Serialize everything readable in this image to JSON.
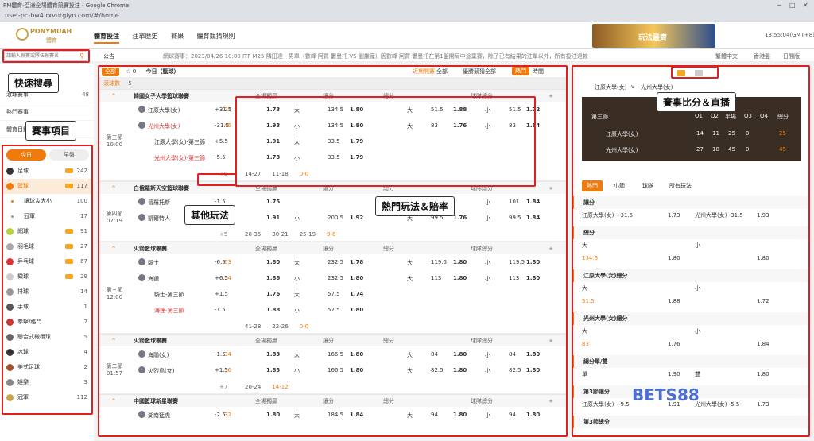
{
  "browser": {
    "title": "PM體育-亞洲全場體育競賽投注 - Google Chrome",
    "url": "user-pc-bw4.rxvutgiyn.com/#/home",
    "controls": [
      "─",
      "□",
      "✕"
    ]
  },
  "header": {
    "brand": "PONYMUAH",
    "brand_sub": "體育",
    "nav": [
      "體育投注",
      "注單歷史",
      "賽果",
      "體育競猜規則"
    ],
    "banner_text": "玩法最齊",
    "clock": "13:55:04(GMT+8)"
  },
  "subbar": {
    "announce_label": "公告",
    "announce": "網球賽事：2023/04/26 10:00 ITF M25 隣田達 - 男單（數峰·阿買 鬱曼托 VS 劉謙龐）因數峰·阿買·鬱曼托在第1盤開局中途棄賽，除了已有結果的注單以外，所有投注退款",
    "lang": "繁體中文",
    "odds_type": "香港盤",
    "theme": "日間版"
  },
  "search": {
    "placeholder": "請輸入聯賽或隊伍聯賽名"
  },
  "labels": {
    "search": "快速搜尋",
    "events": "賽事項目",
    "other": "其他玩法",
    "hot": "熱門玩法＆賠率",
    "live": "賽事比分＆直播"
  },
  "sidebar": {
    "top": [
      {
        "name": "滾球賽事",
        "count": "48"
      },
      {
        "name": "熱門賽事",
        "count": ""
      },
      {
        "name": "體育目錄",
        "count": ""
      }
    ],
    "tabs": [
      "今日",
      "早盤"
    ],
    "sports": [
      {
        "name": "足球",
        "count": "242",
        "color": "#333"
      },
      {
        "name": "籃球",
        "count": "117",
        "color": "#f07b0d",
        "active": true
      },
      {
        "name": "讓球＆大小",
        "count": "100",
        "color": "#f07b0d",
        "sub": true
      },
      {
        "name": "冠軍",
        "count": "17",
        "color": "#999",
        "sub": true
      },
      {
        "name": "網球",
        "count": "91",
        "color": "#b5d23a"
      },
      {
        "name": "羽毛球",
        "count": "27",
        "color": "#aaa"
      },
      {
        "name": "乒乓球",
        "count": "67",
        "color": "#d33"
      },
      {
        "name": "橄球",
        "count": "29",
        "color": "#ccc"
      },
      {
        "name": "排球",
        "count": "14",
        "color": "#999"
      },
      {
        "name": "手球",
        "count": "1",
        "color": "#555"
      },
      {
        "name": "拳擊/格鬥",
        "count": "2",
        "color": "#c33"
      },
      {
        "name": "聯合式橄欖球",
        "count": "5",
        "color": "#666"
      },
      {
        "name": "冰球",
        "count": "4",
        "color": "#333"
      },
      {
        "name": "美式足球",
        "count": "2",
        "color": "#a0522d"
      },
      {
        "name": "娛樂",
        "count": "3",
        "color": "#888"
      },
      {
        "name": "冠軍",
        "count": "112",
        "color": "#c8a24a"
      }
    ]
  },
  "main": {
    "filter_all": "全部",
    "star_count": "0",
    "title": "今日（籃球）",
    "sort_near": "近期開賽",
    "sort_all1": "全部",
    "sort_win": "優勝競猜",
    "sort_all2": "全部",
    "hot": "熱門",
    "time": "時間",
    "live_label": "滾球數",
    "live_count": "5",
    "col_headers": [
      "全場獨贏",
      "讓分",
      "總分",
      "球隊總分"
    ],
    "leagues": [
      {
        "name": "韓國女子大學籃球聯賽",
        "time": "第三節",
        "clock": "10:00",
        "home": "江原大學(女)",
        "away": "光州大學(女)",
        "score_home": "25",
        "score_away": "45",
        "rows": [
          [
            "",
            "+31.5",
            "1.73",
            "大",
            "134.5",
            "1.80",
            "大",
            "51.5",
            "1.88",
            "小",
            "51.5",
            "1.72"
          ],
          [
            "",
            "-31.5",
            "1.93",
            "小",
            "134.5",
            "1.80",
            "大",
            "83",
            "1.76",
            "小",
            "83",
            "1.84"
          ],
          [
            "江原大學(女)-第三節",
            "+5.5",
            "1.91",
            "大",
            "33.5",
            "1.79",
            "",
            "",
            "",
            "",
            "",
            ""
          ],
          [
            "光州大學(女)-第三節",
            "-5.5",
            "1.73",
            "小",
            "33.5",
            "1.79",
            "",
            "",
            "",
            "",
            "",
            ""
          ]
        ],
        "more": "+8",
        "q": [
          "14-27",
          "11-18",
          "0-0"
        ]
      },
      {
        "name": "白俄羅斯天空籃球聯賽",
        "time": "第四節",
        "clock": "07:19",
        "home": "晉羅托斯",
        "away": "凱爾特人",
        "score_home": "",
        "score_away": "",
        "rows": [
          [
            "",
            "-1.5",
            "1.75",
            "",
            "",
            "",
            "",
            "",
            "",
            "小",
            "101",
            "1.84"
          ],
          [
            "",
            "+1.5",
            "1.91",
            "小",
            "200.5",
            "1.92",
            "大",
            "99.5",
            "1.76",
            "小",
            "99.5",
            "1.84"
          ]
        ],
        "more": "+5",
        "q": [
          "20-35",
          "30-21",
          "25-19",
          "9-6"
        ]
      },
      {
        "name": "火箭籃球聯賽",
        "time": "第三節",
        "clock": "12:00",
        "home": "騎士",
        "away": "海狸",
        "score_home": "63",
        "score_away": "54",
        "rows": [
          [
            "",
            "-6.5",
            "1.80",
            "大",
            "232.5",
            "1.78",
            "大",
            "119.5",
            "1.80",
            "小",
            "119.5",
            "1.80"
          ],
          [
            "",
            "+6.5",
            "1.86",
            "小",
            "232.5",
            "1.80",
            "大",
            "113",
            "1.80",
            "小",
            "113",
            "1.80"
          ],
          [
            "騎士-第三節",
            "+1.5",
            "1.76",
            "大",
            "57.5",
            "1.74",
            "",
            "",
            "",
            "",
            "",
            ""
          ],
          [
            "海狸-第三節",
            "-1.5",
            "1.88",
            "小",
            "57.5",
            "1.80",
            "",
            "",
            "",
            "",
            "",
            ""
          ]
        ],
        "more": "",
        "q": [
          "41-28",
          "22-26",
          "0-0"
        ]
      },
      {
        "name": "火箭籃球聯賽",
        "time": "第二節",
        "clock": "01:57",
        "home": "海鵰(女)",
        "away": "火烈鳥(女)",
        "score_home": "34",
        "score_away": "36",
        "rows": [
          [
            "",
            "-1.5",
            "1.83",
            "大",
            "166.5",
            "1.80",
            "大",
            "84",
            "1.80",
            "小",
            "84",
            "1.80"
          ],
          [
            "",
            "+1.5",
            "1.83",
            "小",
            "166.5",
            "1.80",
            "大",
            "82.5",
            "1.80",
            "小",
            "82.5",
            "1.80"
          ]
        ],
        "more": "+7",
        "q": [
          "20-24",
          "14-12"
        ]
      },
      {
        "name": "中國籃球新星聯賽",
        "time": "",
        "clock": "",
        "home": "湖南猛虎",
        "away": "",
        "score_home": "32",
        "score_away": "",
        "rows": [
          [
            "",
            "-2.5",
            "1.80",
            "大",
            "184.5",
            "1.84",
            "大",
            "94",
            "1.80",
            "小",
            "94",
            "1.80"
          ]
        ],
        "more": "",
        "q": []
      }
    ]
  },
  "right": {
    "home": "江原大學(女)",
    "vs": "v",
    "away": "光州大學(女)",
    "period": "第三節",
    "cols": [
      "Q1",
      "Q2",
      "半場",
      "Q3",
      "Q4",
      "總分"
    ],
    "home_scores": [
      "14",
      "11",
      "25",
      "0",
      "",
      "25"
    ],
    "away_scores": [
      "27",
      "18",
      "45",
      "0",
      "",
      "45"
    ],
    "tabs": [
      "熱門",
      "小節",
      "球隊",
      "所有玩法"
    ],
    "sections": [
      {
        "title": "讓分",
        "lines": [
          [
            "江原大學(女) +31.5",
            "1.73",
            "光州大學(女) -31.5",
            "1.93"
          ]
        ]
      },
      {
        "title": "總分",
        "lines": [
          [
            "大",
            "",
            "小",
            ""
          ],
          [
            "134.5",
            "1.80",
            "",
            "1.80"
          ]
        ]
      },
      {
        "title": "江原大學(女)總分",
        "lines": [
          [
            "大",
            "",
            "小",
            ""
          ],
          [
            "51.5",
            "1.88",
            "",
            "1.72"
          ]
        ]
      },
      {
        "title": "光州大學(女)總分",
        "lines": [
          [
            "大",
            "",
            "小",
            ""
          ],
          [
            "83",
            "1.76",
            "",
            "1.84"
          ]
        ]
      },
      {
        "title": "總分單/雙",
        "lines": [
          [
            "單",
            "1.90",
            "雙",
            "1.80"
          ]
        ]
      },
      {
        "title": "第3節讓分",
        "lines": [
          [
            "江原大學(女) +9.5",
            "1.91",
            "光州大學(女) -5.5",
            "1.73"
          ]
        ]
      },
      {
        "title": "第3節總分",
        "lines": []
      }
    ],
    "watermark": "BETS88"
  }
}
